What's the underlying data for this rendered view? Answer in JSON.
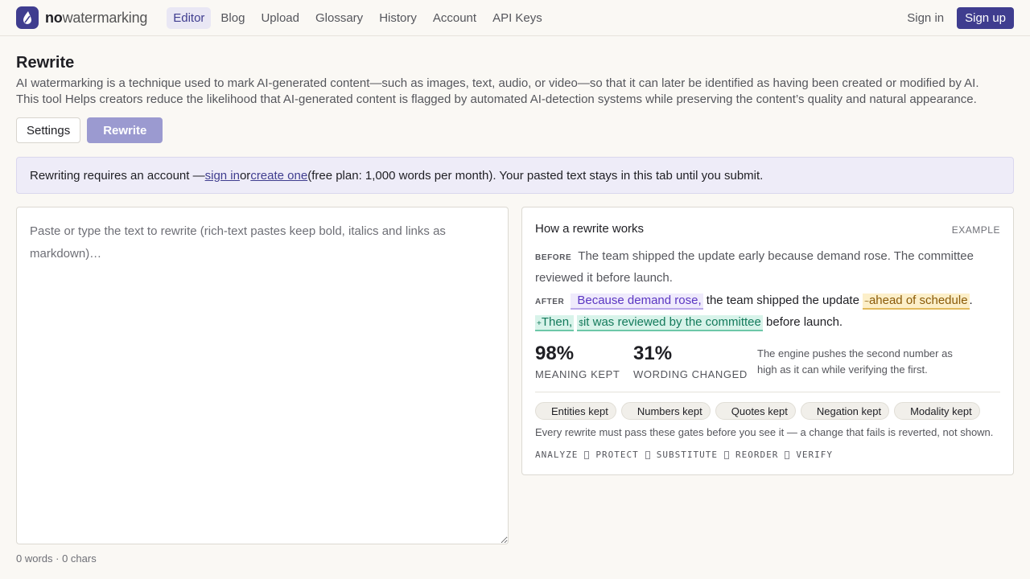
{
  "brand": {
    "name_bold": "no",
    "name_rest": "watermarking"
  },
  "nav": {
    "items": [
      {
        "label": "Editor",
        "active": true
      },
      {
        "label": "Blog"
      },
      {
        "label": "Upload"
      },
      {
        "label": "Glossary"
      },
      {
        "label": "History"
      },
      {
        "label": "Account"
      },
      {
        "label": "API Keys"
      }
    ],
    "sign_in": "Sign in",
    "sign_up": "Sign up"
  },
  "page": {
    "title": "Rewrite",
    "desc1": "AI watermarking is a technique used to mark AI-generated content—such as images, text, audio, or video—so that it can later be identified as having been created or modified by AI.",
    "desc2": "This tool Helps creators reduce the likelihood that AI-generated content is flagged by automated AI-detection systems while preserving the content’s quality and natural appearance."
  },
  "buttons": {
    "settings": "Settings",
    "rewrite": "Rewrite"
  },
  "banner": {
    "pre": "Rewriting requires an account — ",
    "sign_in": "sign in",
    "mid": " or ",
    "create": "create one",
    "post": " (free plan: 1,000 words per month). Your pasted text stays in this tab until you submit."
  },
  "editor": {
    "placeholder": "Paste or type the text to rewrite (rich-text pastes keep bold, italics and links as markdown)…",
    "counts": "0 words · 0 chars"
  },
  "example": {
    "title": "How a rewrite works",
    "badge": "EXAMPLE",
    "before_tag": "BEFORE",
    "before_text": "The team shipped the update early because demand rose. The committee reviewed it before launch.",
    "after_tag": "AFTER",
    "after_seg1": "Because demand rose,",
    "after_seg2": " the team shipped the update ",
    "after_seg3_mark": "~",
    "after_seg3": "ahead of schedule",
    "after_seg4": ". ",
    "after_seg5_mark": "+",
    "after_seg5": "Then,",
    "after_seg6_mark": "$",
    "after_seg6": "it was reviewed by the committee",
    "after_seg7": " before launch.",
    "stats": [
      {
        "value": "98%",
        "label": "MEANING KEPT"
      },
      {
        "value": "31%",
        "label": "WORDING CHANGED"
      }
    ],
    "stats_note": "The engine pushes the second number as high as it can while verifying the first.",
    "chips": [
      "Entities kept",
      "Numbers kept",
      "Quotes kept",
      "Negation kept",
      "Modality kept"
    ],
    "gates_note": "Every rewrite must pass these gates before you see it — a change that fails is reverted, not shown.",
    "pipeline": [
      "ANALYZE",
      "PROTECT",
      "SUBSTITUTE",
      "REORDER",
      "VERIFY"
    ]
  }
}
